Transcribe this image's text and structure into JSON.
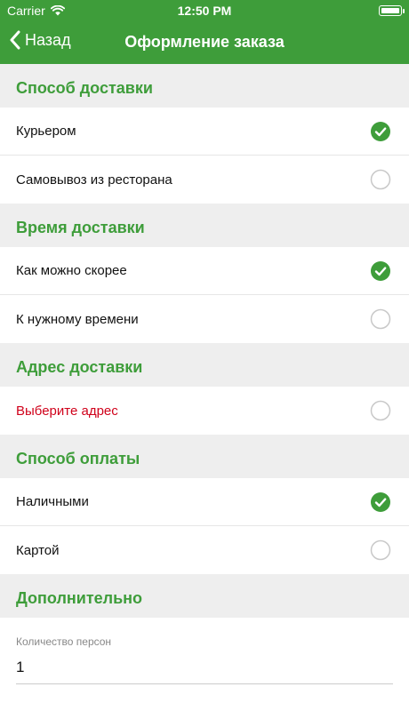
{
  "status_bar": {
    "carrier": "Carrier",
    "time": "12:50 PM"
  },
  "nav": {
    "back_label": "Назад",
    "title": "Оформление заказа"
  },
  "colors": {
    "brand": "#3e9d3a",
    "section_bg": "#eeeeee",
    "alert": "#d0021b"
  },
  "sections": {
    "delivery_method": {
      "title": "Способ доставки",
      "options": [
        {
          "label": "Курьером",
          "selected": true
        },
        {
          "label": "Самовывоз из ресторана",
          "selected": false
        }
      ]
    },
    "delivery_time": {
      "title": "Время доставки",
      "options": [
        {
          "label": "Как можно скорее",
          "selected": true
        },
        {
          "label": "К нужному времени",
          "selected": false
        }
      ]
    },
    "delivery_address": {
      "title": "Адрес доставки",
      "options": [
        {
          "label": "Выберите адрес",
          "selected": false
        }
      ]
    },
    "payment_method": {
      "title": "Способ оплаты",
      "options": [
        {
          "label": "Наличными",
          "selected": true
        },
        {
          "label": "Картой",
          "selected": false
        }
      ]
    },
    "extra": {
      "title": "Дополнительно",
      "persons_label": "Количество персон",
      "persons_value": "1"
    }
  }
}
